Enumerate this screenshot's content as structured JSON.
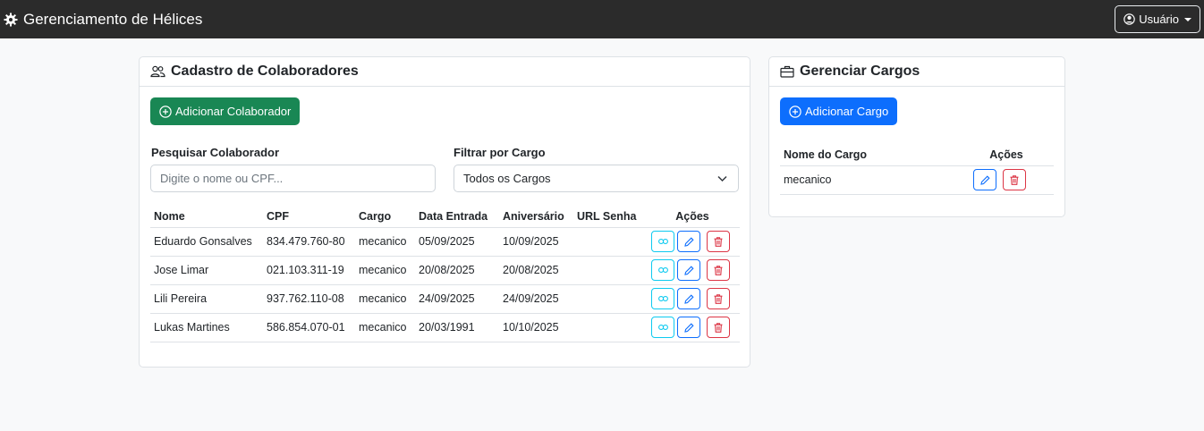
{
  "navbar": {
    "title": "Gerenciamento de Hélices",
    "user_label": "Usuário"
  },
  "colaboradores": {
    "title": "Cadastro de Colaboradores",
    "add_label": "Adicionar Colaborador",
    "search_label": "Pesquisar Colaborador",
    "search_placeholder": "Digite o nome ou CPF...",
    "filter_label": "Filtrar por Cargo",
    "filter_value": "Todos os Cargos",
    "columns": [
      "Nome",
      "CPF",
      "Cargo",
      "Data Entrada",
      "Aniversário",
      "URL Senha",
      "Ações"
    ],
    "rows": [
      {
        "nome": "Eduardo Gonsalves",
        "cpf": "834.479.760-80",
        "cargo": "mecanico",
        "entrada": "05/09/2025",
        "aniversario": "10/09/2025",
        "url": ""
      },
      {
        "nome": "Jose Limar",
        "cpf": "021.103.311-19",
        "cargo": "mecanico",
        "entrada": "20/08/2025",
        "aniversario": "20/08/2025",
        "url": ""
      },
      {
        "nome": "Lili Pereira",
        "cpf": "937.762.110-08",
        "cargo": "mecanico",
        "entrada": "24/09/2025",
        "aniversario": "24/09/2025",
        "url": ""
      },
      {
        "nome": "Lukas Martines",
        "cpf": "586.854.070-01",
        "cargo": "mecanico",
        "entrada": "20/03/1991",
        "aniversario": "10/10/2025",
        "url": ""
      }
    ]
  },
  "cargos": {
    "title": "Gerenciar Cargos",
    "add_label": "Adicionar Cargo",
    "columns": [
      "Nome do Cargo",
      "Ações"
    ],
    "rows": [
      {
        "nome": "mecanico"
      }
    ]
  },
  "colors": {
    "navbar": "#2b2b2b",
    "success": "#198754",
    "primary": "#0d6efd",
    "info": "#0dcaf0",
    "danger": "#dc3545"
  }
}
